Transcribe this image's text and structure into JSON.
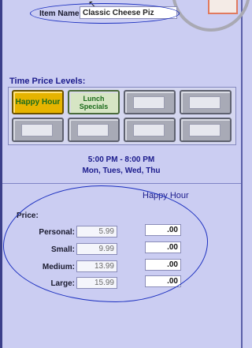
{
  "item": {
    "label": "Item Name:",
    "value": "Classic Cheese Piz"
  },
  "levels": {
    "title": "Time Price Levels:",
    "buttons": [
      {
        "label": "Happy Hour",
        "active": true
      },
      {
        "label": "Lunch\nSpecials",
        "active": false
      },
      {
        "label": "",
        "active": false
      },
      {
        "label": "",
        "active": false
      },
      {
        "label": "",
        "active": false
      },
      {
        "label": "",
        "active": false
      },
      {
        "label": "",
        "active": false
      },
      {
        "label": "",
        "active": false
      }
    ]
  },
  "schedule": {
    "time_range": "5:00 PM - 8:00 PM",
    "days": "Mon, Tues, Wed, Thu"
  },
  "pricing": {
    "column_header": "Happy Hour",
    "price_label": "Price:",
    "rows": [
      {
        "size": "Personal:",
        "base": "5.99",
        "happy_hour": ".00"
      },
      {
        "size": "Small:",
        "base": "9.99",
        "happy_hour": ".00"
      },
      {
        "size": "Medium:",
        "base": "13.99",
        "happy_hour": ".00"
      },
      {
        "size": "Large:",
        "base": "15.99",
        "happy_hour": ".00"
      }
    ]
  },
  "colors": {
    "background": "#cbcdf2",
    "accent_text": "#1b1b8c",
    "annotation_ink": "#1b2fbf",
    "active_button": "#e6b400"
  },
  "icons": [
    "mouse-cursor-icon"
  ]
}
